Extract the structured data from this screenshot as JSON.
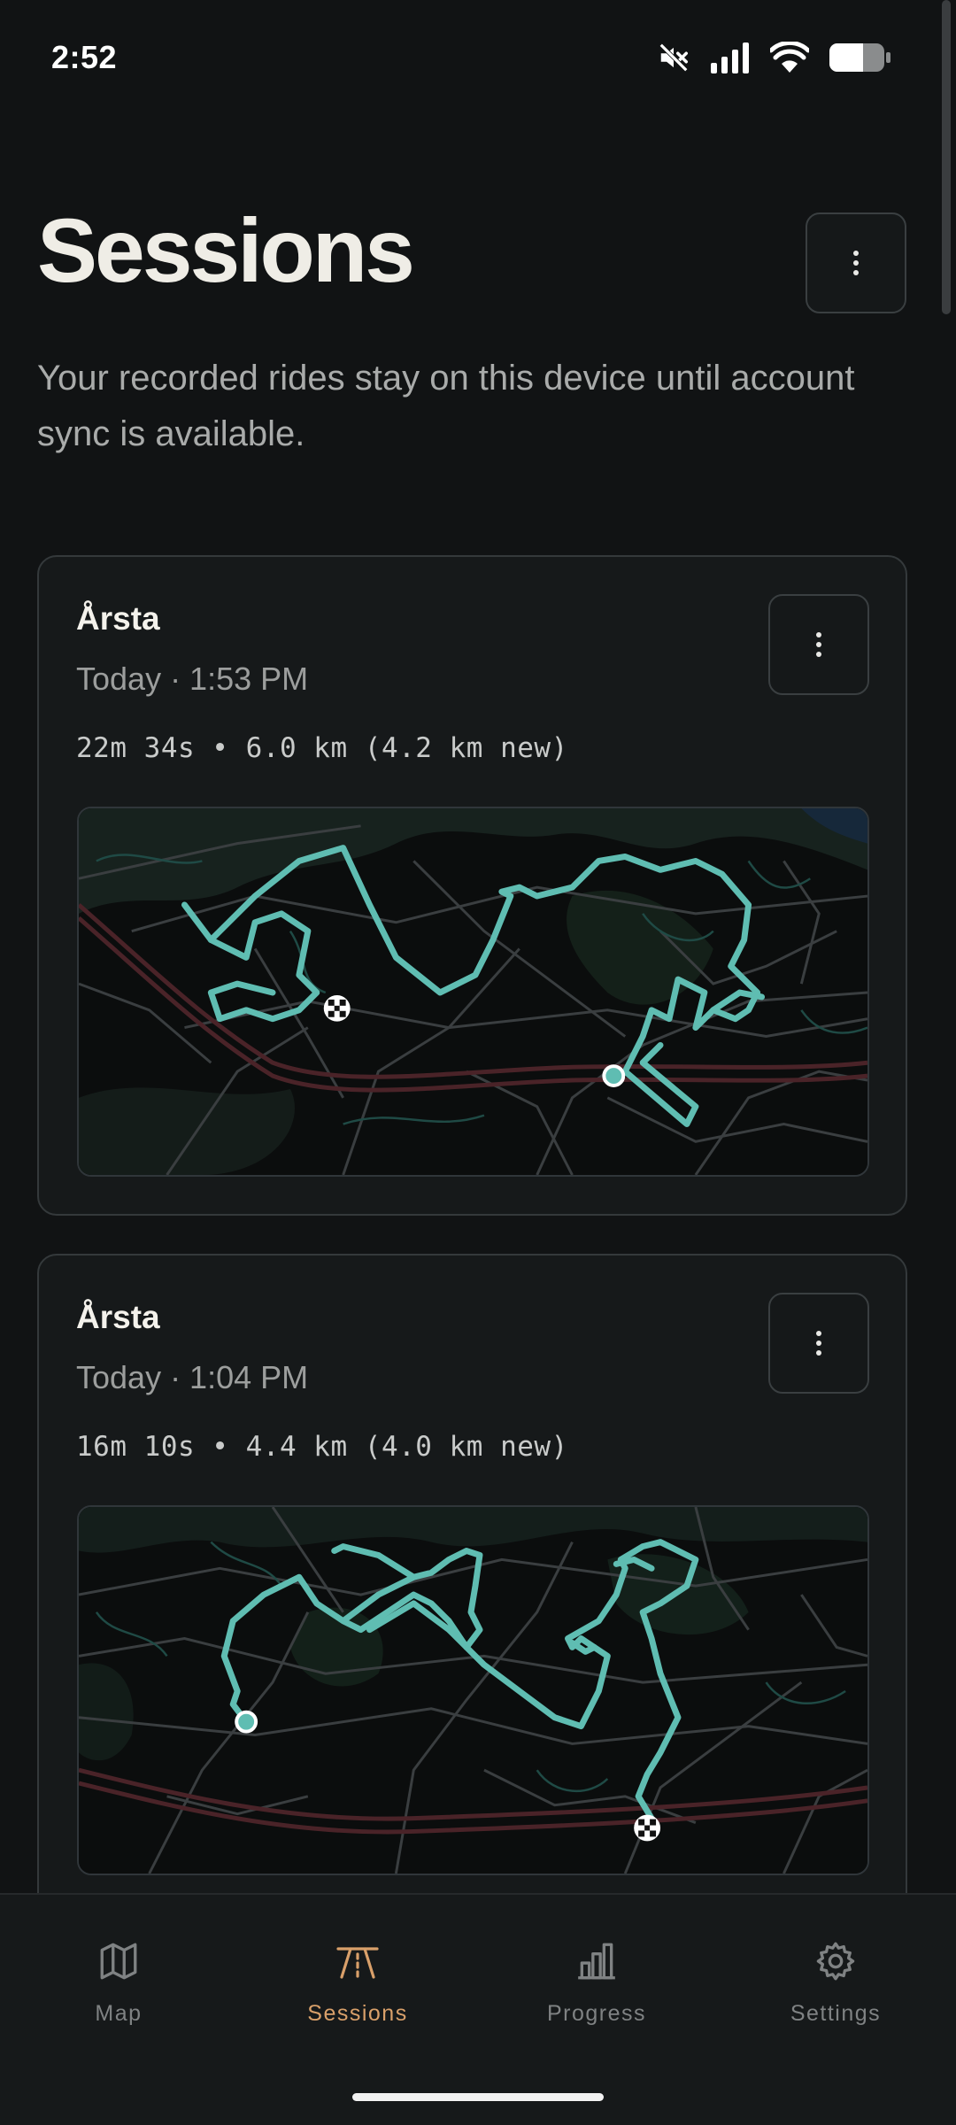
{
  "status_bar": {
    "time": "2:52",
    "icons": [
      "mute-icon",
      "signal-icon",
      "wifi-icon",
      "battery-icon"
    ]
  },
  "header": {
    "title": "Sessions",
    "subtitle": "Your recorded rides stay on this device until account sync is available.",
    "menu_icon": "more-vertical-icon"
  },
  "sessions": [
    {
      "title": "Årsta",
      "time": "Today · 1:53 PM",
      "stats": "22m 34s • 6.0 km (4.2 km new)",
      "menu_icon": "more-vertical-icon"
    },
    {
      "title": "Årsta",
      "time": "Today · 1:04 PM",
      "stats": "16m 10s • 4.4 km (4.0 km new)",
      "menu_icon": "more-vertical-icon"
    }
  ],
  "nav": {
    "active": "Sessions",
    "items": [
      {
        "label": "Map",
        "icon": "map-icon"
      },
      {
        "label": "Sessions",
        "icon": "road-icon"
      },
      {
        "label": "Progress",
        "icon": "bar-chart-icon"
      },
      {
        "label": "Settings",
        "icon": "gear-icon"
      }
    ]
  },
  "colors": {
    "background": "#111314",
    "card": "#16191a",
    "route": "#5fbdb2",
    "accent": "#d9a06a",
    "muted_text": "#9c9e9d"
  }
}
